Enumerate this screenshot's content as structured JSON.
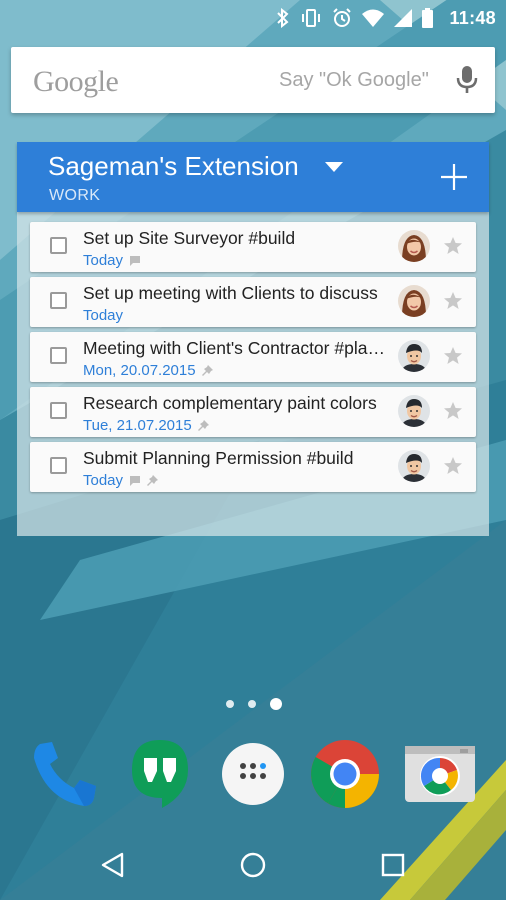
{
  "status_bar": {
    "time": "11:48",
    "icons": [
      "bluetooth-icon",
      "vibrate-icon",
      "alarm-icon",
      "wifi-icon",
      "cell-signal-icon",
      "battery-icon"
    ]
  },
  "search_bar": {
    "logo": "Google",
    "hint": "Say \"Ok Google\"",
    "icon": "microphone-icon"
  },
  "widget": {
    "title": "Sageman's Extension",
    "list_name": "WORK",
    "accent_color": "#2e7fd8",
    "tasks": [
      {
        "title": "Set up Site Surveyor #build",
        "due": "Today",
        "has_comment": true,
        "pinned": false,
        "assignee": "woman-avatar",
        "starred": false
      },
      {
        "title": "Set up meeting with Clients to discuss",
        "due": "Today",
        "has_comment": false,
        "pinned": false,
        "assignee": "woman-avatar",
        "starred": false
      },
      {
        "title": "Meeting with Client's Contractor #planning",
        "due": "Mon, 20.07.2015",
        "has_comment": false,
        "pinned": true,
        "assignee": "man-avatar",
        "starred": false
      },
      {
        "title": "Research complementary paint colors",
        "due": "Tue, 21.07.2015",
        "has_comment": false,
        "pinned": true,
        "assignee": "man-avatar",
        "starred": false
      },
      {
        "title": "Submit Planning Permission #build",
        "due": "Today",
        "has_comment": true,
        "pinned": true,
        "assignee": "man-avatar",
        "starred": false
      }
    ]
  },
  "home_pages": {
    "count": 3,
    "active_index": 2
  },
  "dock": [
    "phone-icon",
    "hangouts-icon",
    "app-drawer-icon",
    "chrome-icon",
    "camera-icon"
  ],
  "nav_bar": [
    "back-icon",
    "home-icon",
    "recents-icon"
  ]
}
